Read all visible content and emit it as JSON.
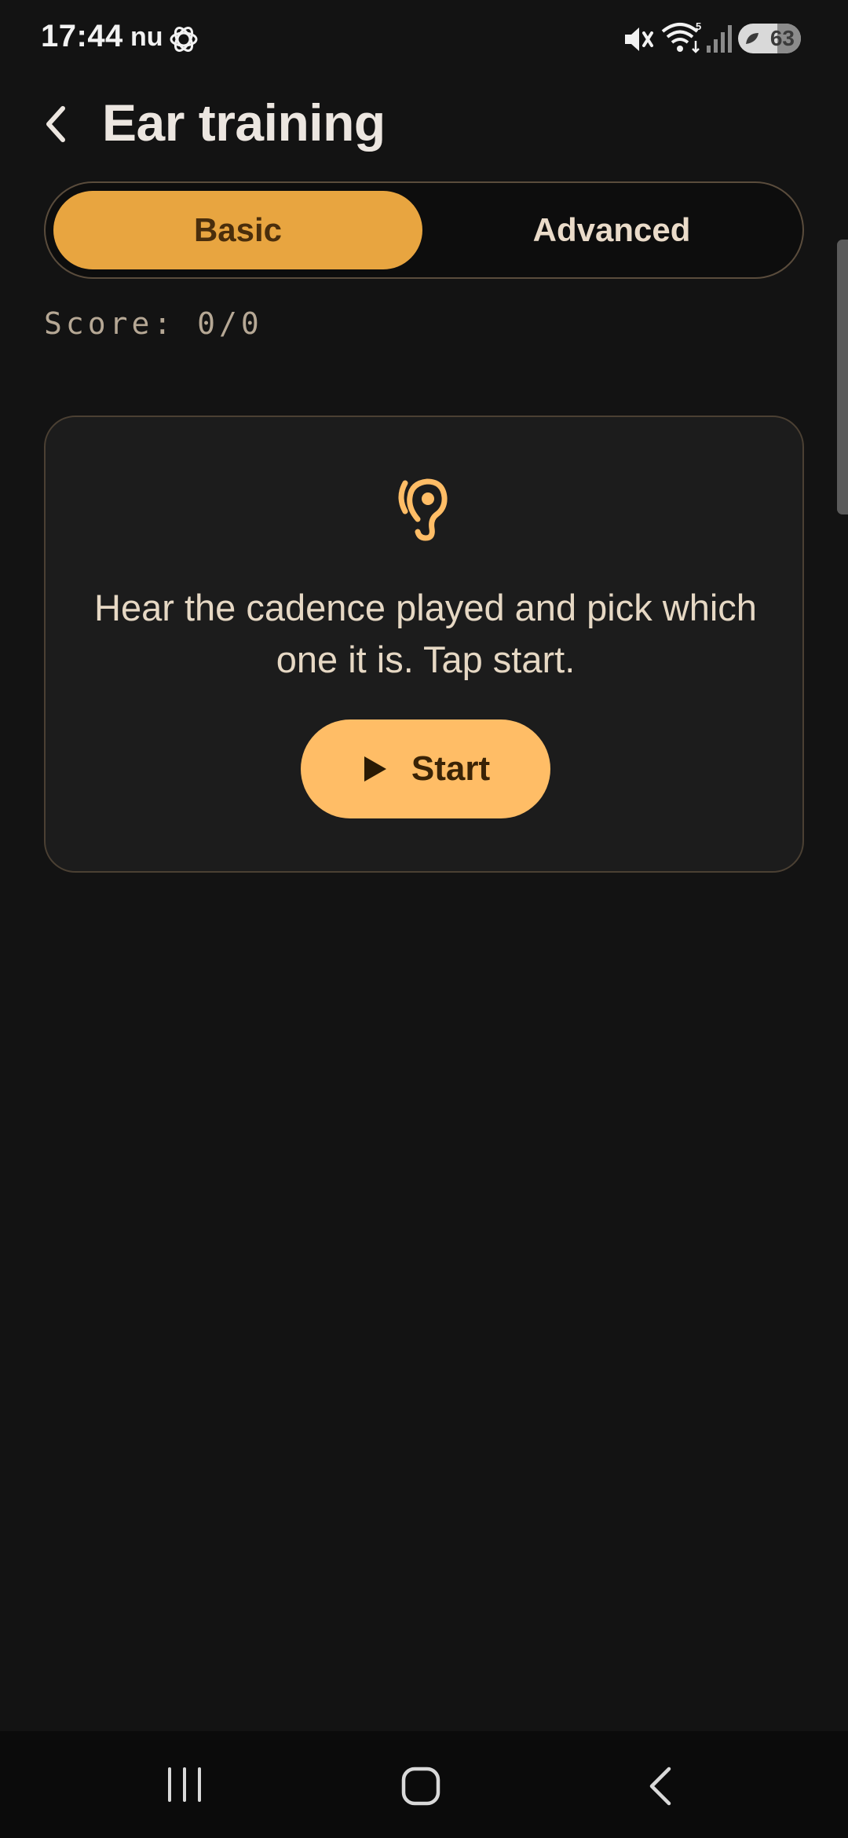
{
  "status_bar": {
    "time": "17:44",
    "carrier": "nu",
    "battery": "63",
    "icons": [
      "chatgpt-icon",
      "mute-icon",
      "wifi-icon",
      "signal-icon",
      "battery-icon"
    ]
  },
  "header": {
    "title": "Ear training",
    "back_icon": "chevron-left-icon"
  },
  "tabs": [
    {
      "label": "Basic",
      "selected": true
    },
    {
      "label": "Advanced",
      "selected": false
    }
  ],
  "score": {
    "text": "Score: 0/0"
  },
  "card": {
    "icon": "ear-icon",
    "instruction": "Hear the cadence played and pick which one it is. Tap start.",
    "start_label": "Start",
    "start_icon": "play-icon"
  },
  "colors": {
    "accent": "#e8a540",
    "button": "#ffbd66",
    "background": "#131313",
    "card": "#1c1c1c"
  },
  "nav_bar": {
    "icons": [
      "recent-apps-icon",
      "home-icon",
      "back-icon"
    ]
  }
}
